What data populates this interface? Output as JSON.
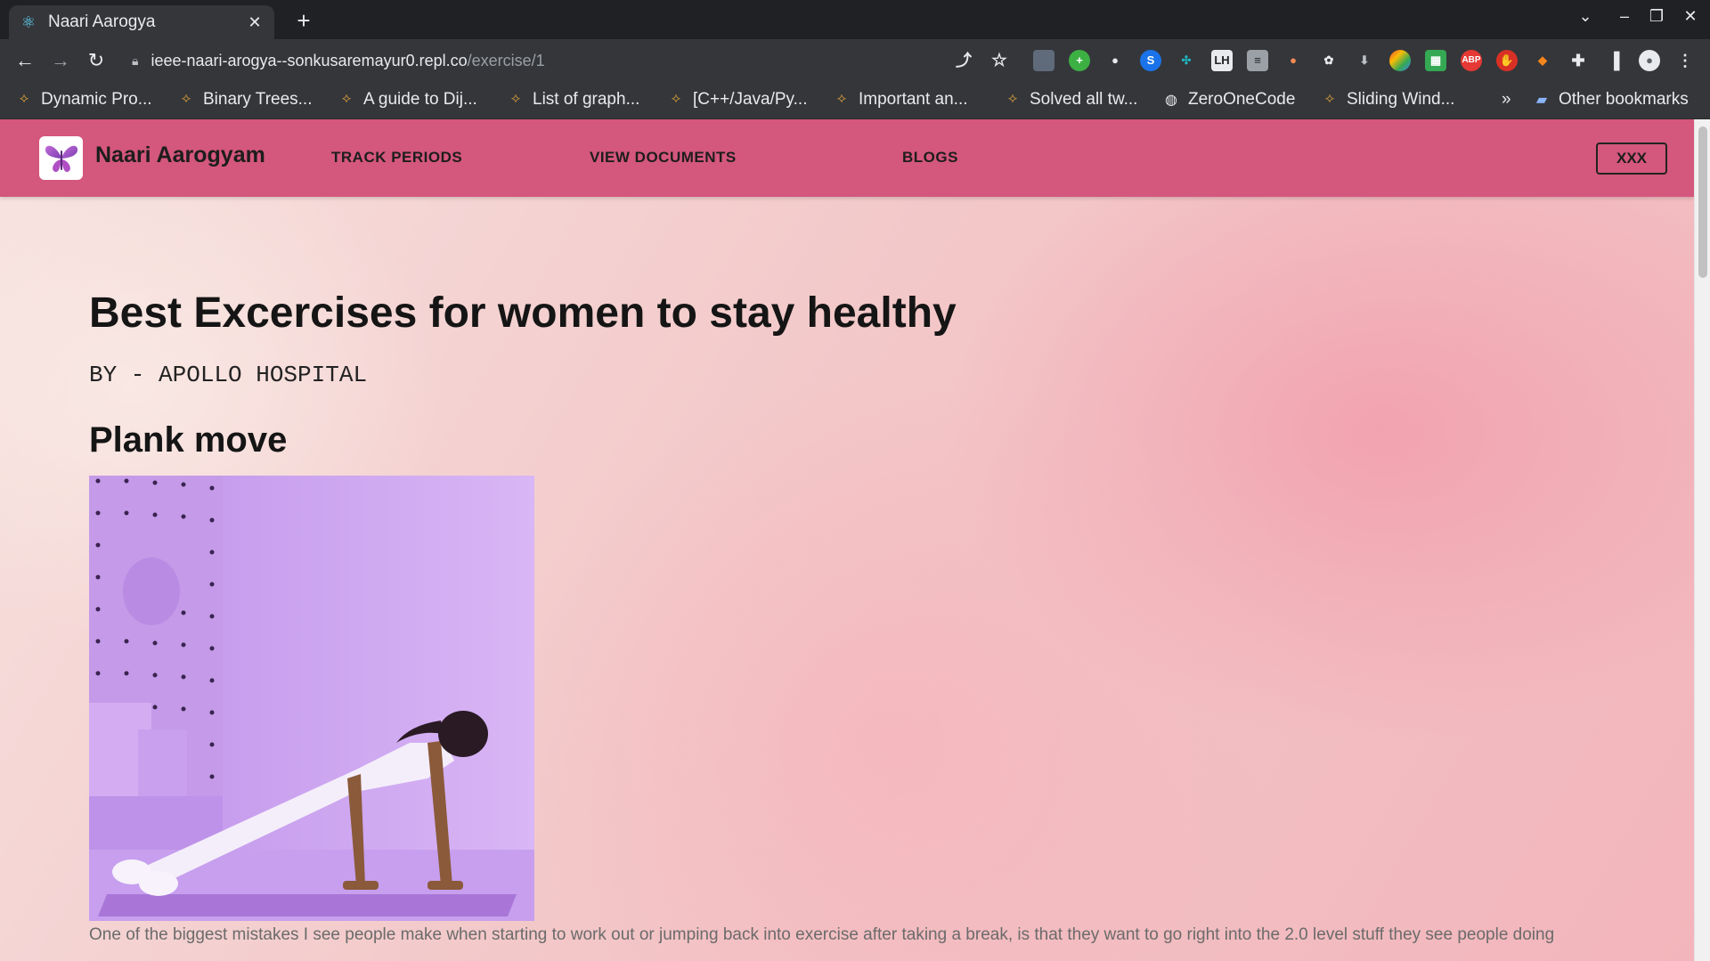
{
  "browser": {
    "tab_title": "Naari Aarogya",
    "url_host": "ieee-naari-arogya--sonkusaremayur0.repl.co",
    "url_path": "/exercise/1",
    "bookmarks": [
      "Dynamic Pro...",
      "Binary Trees...",
      "A guide to Dij...",
      "List of graph...",
      "[C++/Java/Py...",
      "Important an...",
      "Solved all tw...",
      "ZeroOneCode",
      "Sliding Wind..."
    ],
    "bookmarks_overflow": "»",
    "other_bookmarks": "Other bookmarks",
    "extension_abp": "ABP"
  },
  "app": {
    "brand": "Naari Aarogyam",
    "nav": [
      "TRACK PERIODS",
      "VIEW DOCUMENTS",
      "BLOGS"
    ],
    "user_button": "XXX"
  },
  "article": {
    "title": "Best Excercises for women to stay healthy",
    "author": "BY - APOLLO HOSPITAL",
    "section_title": "Plank move",
    "paragraph": "One of the biggest mistakes I see people make when starting to work out or jumping back into exercise after taking a break, is that they want to go right into the 2.0 level stuff they see people doing"
  },
  "colors": {
    "appbar": "#d4577d",
    "photo_background": "#c9a3ef"
  },
  "icons": {
    "logo": "butterfly-icon",
    "favicon": "react-icon"
  }
}
